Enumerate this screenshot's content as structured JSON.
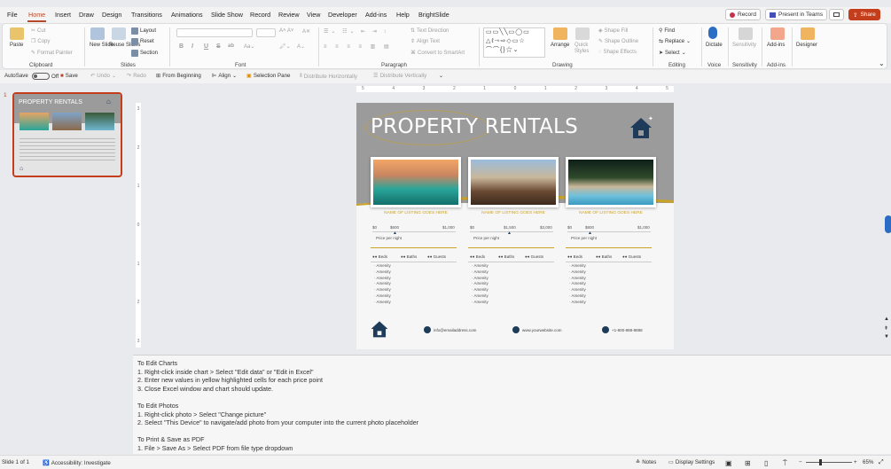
{
  "menu": {
    "tabs": [
      "File",
      "Home",
      "Insert",
      "Draw",
      "Design",
      "Transitions",
      "Animations",
      "Slide Show",
      "Record",
      "Review",
      "View",
      "Developer",
      "Add-ins",
      "Help",
      "BrightSlide"
    ],
    "active": "Home",
    "record_label": "Record",
    "present_label": "Present in Teams",
    "share_label": "Share"
  },
  "ribbon": {
    "clipboard": {
      "paste": "Paste",
      "cut": "Cut",
      "copy": "Copy",
      "format_painter": "Format Painter",
      "label": "Clipboard"
    },
    "slides": {
      "new_slide": "New Slide",
      "reuse_slides": "Reuse Slides",
      "layout": "Layout",
      "reset": "Reset",
      "section": "Section",
      "label": "Slides"
    },
    "font": {
      "label": "Font",
      "bold": "B",
      "italic": "I",
      "underline": "U",
      "strike": "S",
      "spacing": "ab"
    },
    "paragraph": {
      "label": "Paragraph",
      "text_direction": "Text Direction",
      "align_text": "Align Text",
      "smartart": "Convert to SmartArt"
    },
    "drawing": {
      "label": "Drawing",
      "arrange": "Arrange",
      "quick_styles": "Quick Styles",
      "shape_fill": "Shape Fill",
      "shape_outline": "Shape Outline",
      "shape_effects": "Shape Effects"
    },
    "editing": {
      "label": "Editing",
      "find": "Find",
      "replace": "Replace",
      "select": "Select"
    },
    "voice": {
      "label": "Voice",
      "dictate": "Dictate"
    },
    "sensitivity": {
      "label": "Sensitivity",
      "button": "Sensitivity"
    },
    "addins": {
      "label": "Add-ins",
      "button": "Add-ins"
    },
    "designer": {
      "button": "Designer"
    }
  },
  "qat": {
    "autosave": "AutoSave",
    "autosave_state": "Off",
    "save": "Save",
    "undo": "Undo",
    "redo": "Redo",
    "from_beginning": "From Beginning",
    "align": "Align",
    "selection_pane": "Selection Pane",
    "distribute_h": "Distribute Horizontally",
    "distribute_v": "Distribute Vertically"
  },
  "thumbnail": {
    "number": "1",
    "title": "PROPERTY RENTALS"
  },
  "ruler": {
    "h_ticks": [
      "5",
      "4",
      "3",
      "2",
      "1",
      "0",
      "1",
      "2",
      "3",
      "4",
      "5"
    ],
    "v_ticks": [
      "3",
      "2",
      "1",
      "0",
      "1",
      "2",
      "3"
    ]
  },
  "slide": {
    "title": "PROPERTY RENTALS",
    "listings": [
      {
        "name": "NAME OF LISTING GOES HERE",
        "min": "$0",
        "price": "$600",
        "max": "$1,000",
        "price_note": "Price per night",
        "beds": "●● Beds",
        "baths": "●● Baths",
        "guests": "●● Guests",
        "amenities": [
          "Amenity",
          "Amenity",
          "Amenity",
          "Amenity",
          "Amenity",
          "Amenity",
          "Amenity"
        ]
      },
      {
        "name": "NAME OF LISTING GOES HERE",
        "min": "$0",
        "price": "$1,500",
        "max": "$3,000",
        "price_note": "Price per night",
        "beds": "●● Beds",
        "baths": "●● Baths",
        "guests": "●● Guests",
        "amenities": [
          "Amenity",
          "Amenity",
          "Amenity",
          "Amenity",
          "Amenity",
          "Amenity",
          "Amenity"
        ]
      },
      {
        "name": "NAME OF LISTING GOES HERE",
        "min": "$0",
        "price": "$800",
        "max": "$1,000",
        "price_note": "Price per night",
        "beds": "●● Beds",
        "baths": "●● Baths",
        "guests": "●● Guests",
        "amenities": [
          "Amenity",
          "Amenity",
          "Amenity",
          "Amenity",
          "Amenity",
          "Amenity",
          "Amenity"
        ]
      }
    ],
    "email": "info@emailaddress.com",
    "website": "www.yourwebsite.com",
    "phone": "+1-800-888-8888"
  },
  "notes": {
    "lines": [
      "To Edit Charts",
      "1.   Right-click inside chart > Select \"Edit data\" or \"Edit in Excel\"",
      "2.   Enter new values in yellow highlighted cells for each price point",
      "3.   Close Excel window and chart should update.",
      "",
      "To Edit Photos",
      "1.   Right-click photo > Select \"Change picture\"",
      "2.   Select \"This Device\" to navigate/add photo from your computer into the current photo placeholder",
      "",
      "To Print & Save as PDF",
      "1. File > Save As >  Select PDF from file type dropdown"
    ]
  },
  "status": {
    "slide_count": "Slide 1 of 1",
    "accessibility": "Accessibility: Investigate",
    "notes": "Notes",
    "display_settings": "Display Settings",
    "zoom": "65%",
    "zoom_minus": "−",
    "zoom_plus": "+"
  },
  "colors": {
    "accent": "#b7472a",
    "slide_gray": "#9b9b9b",
    "gold": "#c9a227",
    "navy": "#1f3b5a"
  }
}
